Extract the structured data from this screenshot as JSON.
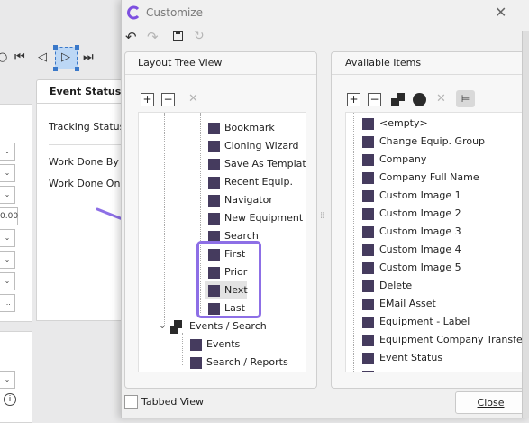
{
  "background_app": {
    "tab_label": "Event Status",
    "fields": [
      "Tracking Status",
      "Work Done By",
      "Work Done On"
    ],
    "value_fragment": "0.00",
    "more_button": "..."
  },
  "dialog": {
    "title": "Customize",
    "layout_tree": {
      "title": "Layout Tree View",
      "items": [
        "Bookmark",
        "Cloning Wizard",
        "Save As Template",
        "Recent Equip.",
        "Navigator",
        "New Equipment",
        "Search",
        "First",
        "Prior",
        "Next",
        "Last",
        "Events / Search",
        "Events",
        "Search / Reports"
      ],
      "highlighted_items": [
        "First",
        "Prior",
        "Next",
        "Last"
      ],
      "selected_item": "Next"
    },
    "available_items": {
      "title": "Available Items",
      "items": [
        "<empty>",
        "Change Equip. Group",
        "Company",
        "Company Full Name",
        "Custom Image 1",
        "Custom Image 2",
        "Custom Image 3",
        "Custom Image 4",
        "Custom Image 5",
        "Delete",
        "EMail Asset",
        "Equipment - Label",
        "Equipment Company Transfer",
        "Event Status"
      ]
    },
    "tabbed_view_label": "Tabbed View",
    "close_button": "Close"
  },
  "colors": {
    "highlight": "#8d6fe6",
    "item_icon": "#453b5e",
    "logo": "#7d4fe0"
  }
}
